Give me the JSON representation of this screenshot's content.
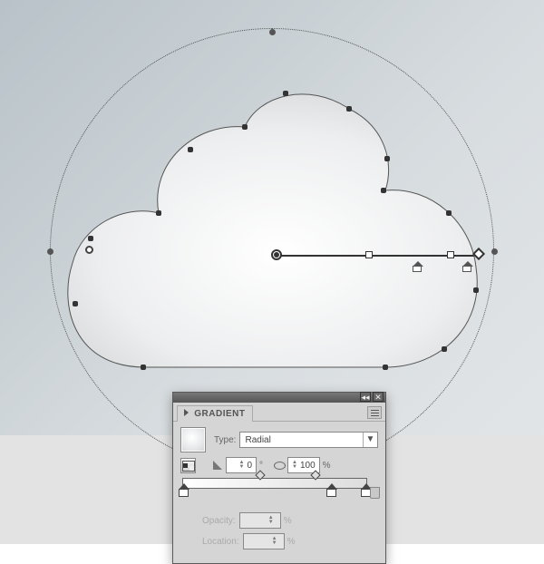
{
  "panel": {
    "title": "GRADIENT",
    "type_label": "Type:",
    "type_value": "Radial",
    "angle_value": "0",
    "angle_suffix": "°",
    "aspect_value": "100",
    "aspect_suffix": "%",
    "opacity_label": "Opacity:",
    "opacity_suffix": "%",
    "location_label": "Location:",
    "location_suffix": "%",
    "collapse_glyph": "◂◂",
    "close_glyph": "✕"
  }
}
